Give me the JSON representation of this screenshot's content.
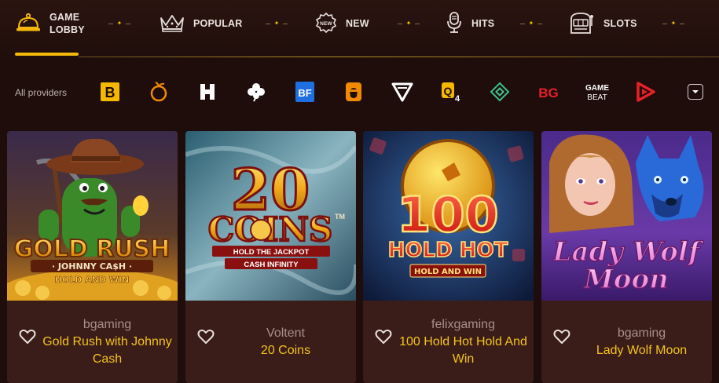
{
  "nav": {
    "items": [
      {
        "label": "GAME LOBBY",
        "icon": "bell-icon",
        "active": true
      },
      {
        "label": "POPULAR",
        "icon": "crown-icon",
        "active": false
      },
      {
        "label": "NEW",
        "icon": "new-badge-icon",
        "active": false
      },
      {
        "label": "HITS",
        "icon": "microphone-icon",
        "active": false
      },
      {
        "label": "SLOTS",
        "icon": "slot-machine-icon",
        "active": false
      }
    ]
  },
  "providers": {
    "all_label": "All providers",
    "logos": [
      {
        "name": "bgaming-logo",
        "text": "B"
      },
      {
        "name": "peach-logo",
        "text": ""
      },
      {
        "name": "h-logo",
        "text": "H"
      },
      {
        "name": "clover-logo",
        "text": ""
      },
      {
        "name": "bf-logo",
        "text": "BF"
      },
      {
        "name": "acorn-logo",
        "text": ""
      },
      {
        "name": "v-logo",
        "text": ""
      },
      {
        "name": "q4-logo",
        "text": "Q"
      },
      {
        "name": "diamond-logo",
        "text": ""
      },
      {
        "name": "bg-logo",
        "text": "BG"
      },
      {
        "name": "gamebeat-logo",
        "text": "GAME BEAT"
      },
      {
        "name": "play-logo",
        "text": ""
      }
    ]
  },
  "games": [
    {
      "provider": "bgaming",
      "title": "Gold Rush with Johnny Cash",
      "art": {
        "title": "GOLD RUSH",
        "subtitle": "· JOHNNY CA$H ·",
        "tagline": "HOLD AND WIN"
      }
    },
    {
      "provider": "Voltent",
      "title": "20 Coins",
      "art": {
        "title": "20",
        "subtitle": "COINS",
        "tagline": "HOLD THE JACKPOT",
        "tagline2": "CASH INFINITY",
        "tm": "TM"
      }
    },
    {
      "provider": "felixgaming",
      "title": "100 Hold Hot Hold And Win",
      "art": {
        "title": "100",
        "subtitle": "HOLD HOT",
        "tagline": "HOLD AND WIN"
      }
    },
    {
      "provider": "bgaming",
      "title": "Lady Wolf Moon",
      "art": {
        "title": "Lady Wolf",
        "subtitle": "Moon"
      }
    }
  ],
  "colors": {
    "accent": "#f3b90b",
    "background": "#1e0d0b",
    "card": "#3a1c18",
    "game_title": "#f4c51c",
    "provider_text": "#a8908a"
  }
}
